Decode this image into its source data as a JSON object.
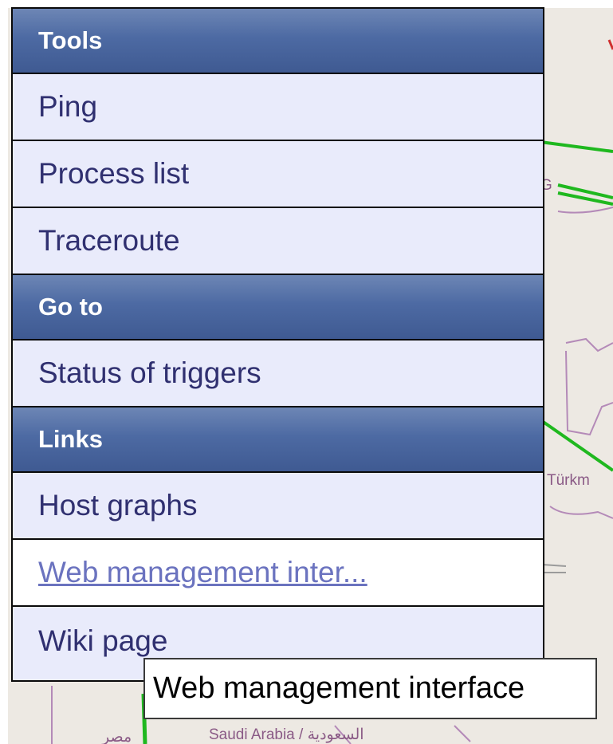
{
  "menu": {
    "sections": [
      {
        "title": "Tools",
        "items": [
          "Ping",
          "Process list",
          "Traceroute"
        ]
      },
      {
        "title": "Go to",
        "items": [
          "Status of triggers"
        ]
      },
      {
        "title": "Links",
        "items": [
          "Host graphs",
          "Web management inter...",
          "Wiki page"
        ]
      }
    ]
  },
  "tooltip": {
    "text": "Web management interface"
  },
  "map": {
    "labels": [
      "G",
      "Türkm",
      "Saudi Arabia / السعودية",
      "مصر"
    ],
    "colors": {
      "link_line": "#1fb81f",
      "border": "#b48ab8",
      "land": "#ede9e3"
    }
  }
}
